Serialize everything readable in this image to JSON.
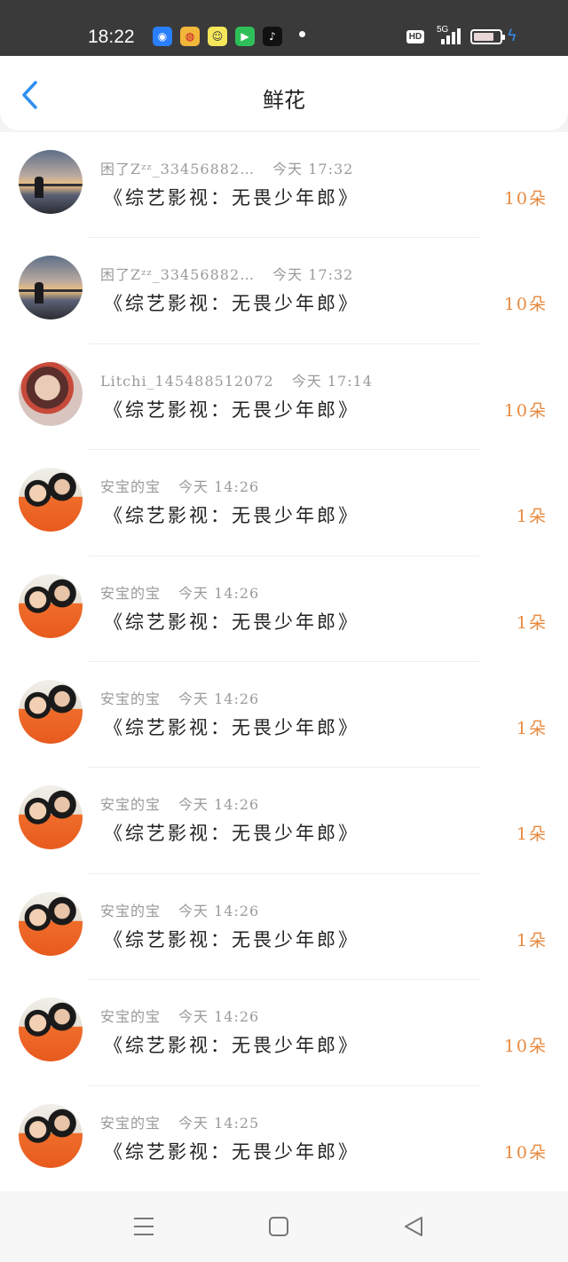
{
  "status_bar": {
    "time": "18:22",
    "hd": "HD",
    "network": "5G",
    "icons": [
      "browser-icon",
      "weibo-icon",
      "chat-app-icon",
      "video-play-icon",
      "tiktok-icon"
    ]
  },
  "header": {
    "title": "鲜花",
    "back_icon": "chevron-left-icon",
    "accent_color": "#2f8ff0"
  },
  "records": [
    {
      "user": "困了Zᶻᶻ_33456882…",
      "time": "今天 17:32",
      "show": "《综艺影视：无畏少年郎》",
      "count": "10朵",
      "avatar": "sunset"
    },
    {
      "user": "困了Zᶻᶻ_33456882…",
      "time": "今天 17:32",
      "show": "《综艺影视：无畏少年郎》",
      "count": "10朵",
      "avatar": "sunset"
    },
    {
      "user": "Litchi_145488512072",
      "time": "今天 17:14",
      "show": "《综艺影视：无畏少年郎》",
      "count": "10朵",
      "avatar": "girl"
    },
    {
      "user": "安宝的宝",
      "time": "今天 14:26",
      "show": "《综艺影视：无畏少年郎》",
      "count": "1朵",
      "avatar": "couple"
    },
    {
      "user": "安宝的宝",
      "time": "今天 14:26",
      "show": "《综艺影视：无畏少年郎》",
      "count": "1朵",
      "avatar": "couple"
    },
    {
      "user": "安宝的宝",
      "time": "今天 14:26",
      "show": "《综艺影视：无畏少年郎》",
      "count": "1朵",
      "avatar": "couple"
    },
    {
      "user": "安宝的宝",
      "time": "今天 14:26",
      "show": "《综艺影视：无畏少年郎》",
      "count": "1朵",
      "avatar": "couple"
    },
    {
      "user": "安宝的宝",
      "time": "今天 14:26",
      "show": "《综艺影视：无畏少年郎》",
      "count": "1朵",
      "avatar": "couple"
    },
    {
      "user": "安宝的宝",
      "time": "今天 14:26",
      "show": "《综艺影视：无畏少年郎》",
      "count": "10朵",
      "avatar": "couple"
    },
    {
      "user": "安宝的宝",
      "time": "今天 14:25",
      "show": "《综艺影视：无畏少年郎》",
      "count": "10朵",
      "avatar": "couple"
    }
  ],
  "nav": {
    "icons": [
      "menu-icon",
      "home-square-icon",
      "back-triangle-icon"
    ]
  },
  "colors": {
    "count": "#e8893f",
    "meta": "#9a9a9a",
    "status_bar_bg": "#3a3a3a"
  }
}
